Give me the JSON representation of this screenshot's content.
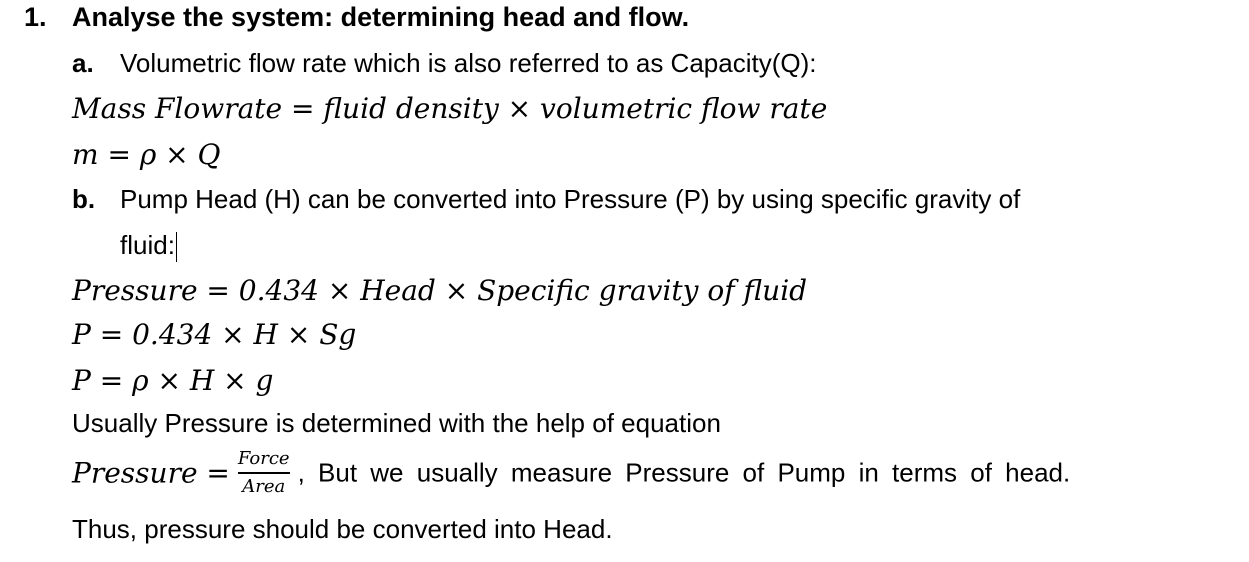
{
  "heading": {
    "number": "1.",
    "text": "Analyse the system: determining head and flow."
  },
  "item_a": {
    "label": "a.",
    "text": "Volumetric flow rate which is also referred to as Capacity(Q):"
  },
  "eq_mass_flow": "Mass Flowrate = fluid density × volumetric flow rate",
  "eq_m": "m = ρ × Q",
  "item_b": {
    "label": "b.",
    "text_line1": "Pump Head (H) can be converted into Pressure (P) by using specific gravity of",
    "text_line2": "fluid:"
  },
  "eq_pressure_head": "Pressure = 0.434 × Head × Specific gravity of fluid",
  "eq_p_sg": "P = 0.434 × H × Sg",
  "eq_p_rho": "P = ρ × H × g",
  "usually_text": "Usually Pressure is determined with the help of equation",
  "eq_force_area": {
    "lhs": "Pressure =",
    "numerator": "Force",
    "denominator": "Area",
    "trailing_text": ", But we usually measure Pressure of Pump in terms of head."
  },
  "conclusion": "Thus, pressure should be converted into Head."
}
